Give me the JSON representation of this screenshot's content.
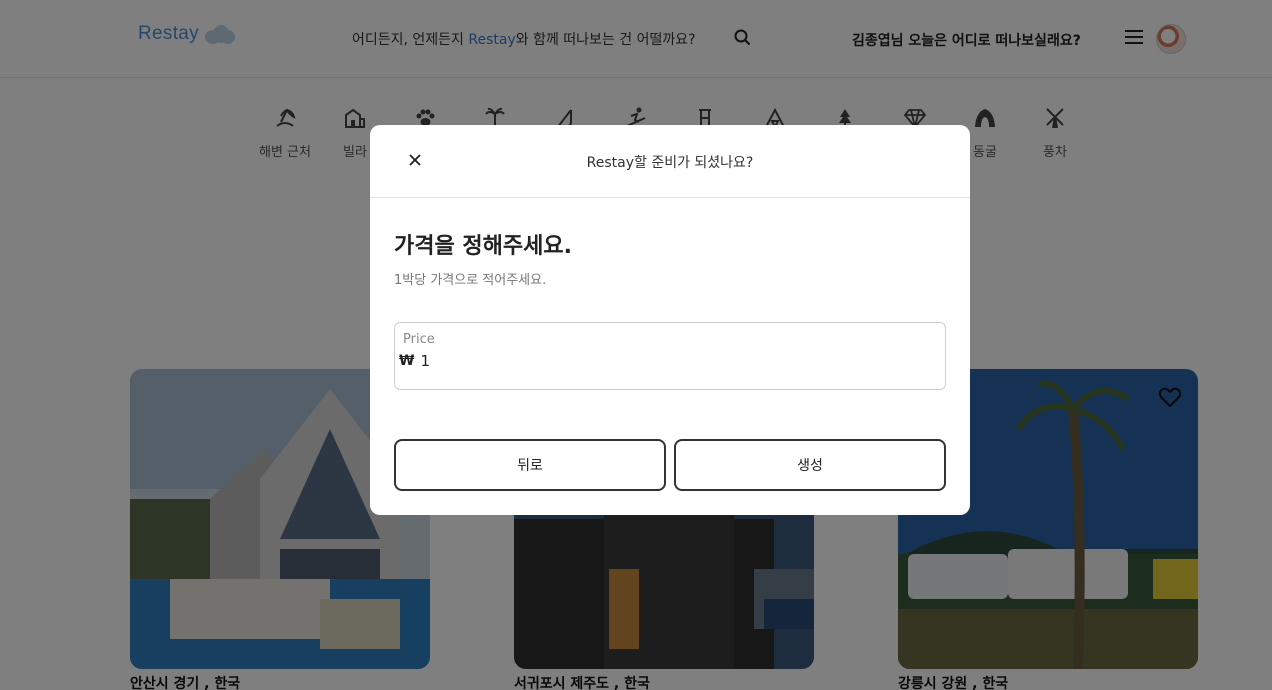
{
  "header": {
    "logo_text": "Restay",
    "search_prompt_pre": "어디든지, 언제든지 ",
    "search_prompt_brand": "Restay",
    "search_prompt_post": "와 함께 떠나보는 건 어떨까요?",
    "greeting": "김종엽님 오늘은 어디로 떠나보실래요?"
  },
  "categories": [
    {
      "label": "해변 근처",
      "icon": "beach-icon"
    },
    {
      "label": "빌라",
      "icon": "villa-icon"
    },
    {
      "label": "",
      "icon": "paw-icon"
    },
    {
      "label": "",
      "icon": "palm-icon"
    },
    {
      "label": "",
      "icon": "fishing-icon"
    },
    {
      "label": "",
      "icon": "ski-icon"
    },
    {
      "label": "",
      "icon": "tower-icon"
    },
    {
      "label": "",
      "icon": "camping-icon"
    },
    {
      "label": "",
      "icon": "tree-icon"
    },
    {
      "label": "",
      "icon": "diamond-icon"
    },
    {
      "label": "동굴",
      "icon": "cave-icon"
    },
    {
      "label": "풍차",
      "icon": "windmill-icon"
    }
  ],
  "listings": [
    {
      "location": "안산시 경기 , 한국"
    },
    {
      "location": "서귀포시 제주도 , 한국"
    },
    {
      "location": "강릉시 강원 , 한국"
    }
  ],
  "modal": {
    "title": "Restay할 준비가 되셨나요?",
    "heading": "가격을 정해주세요.",
    "subtitle": "1박당 가격으로 적어주세요.",
    "price_label": "Price",
    "currency": "₩",
    "price_value": "1",
    "back_label": "뒤로",
    "create_label": "생성"
  },
  "colors": {
    "brand": "#4f8fd6",
    "overlay": "rgba(0,0,0,0.5)"
  }
}
